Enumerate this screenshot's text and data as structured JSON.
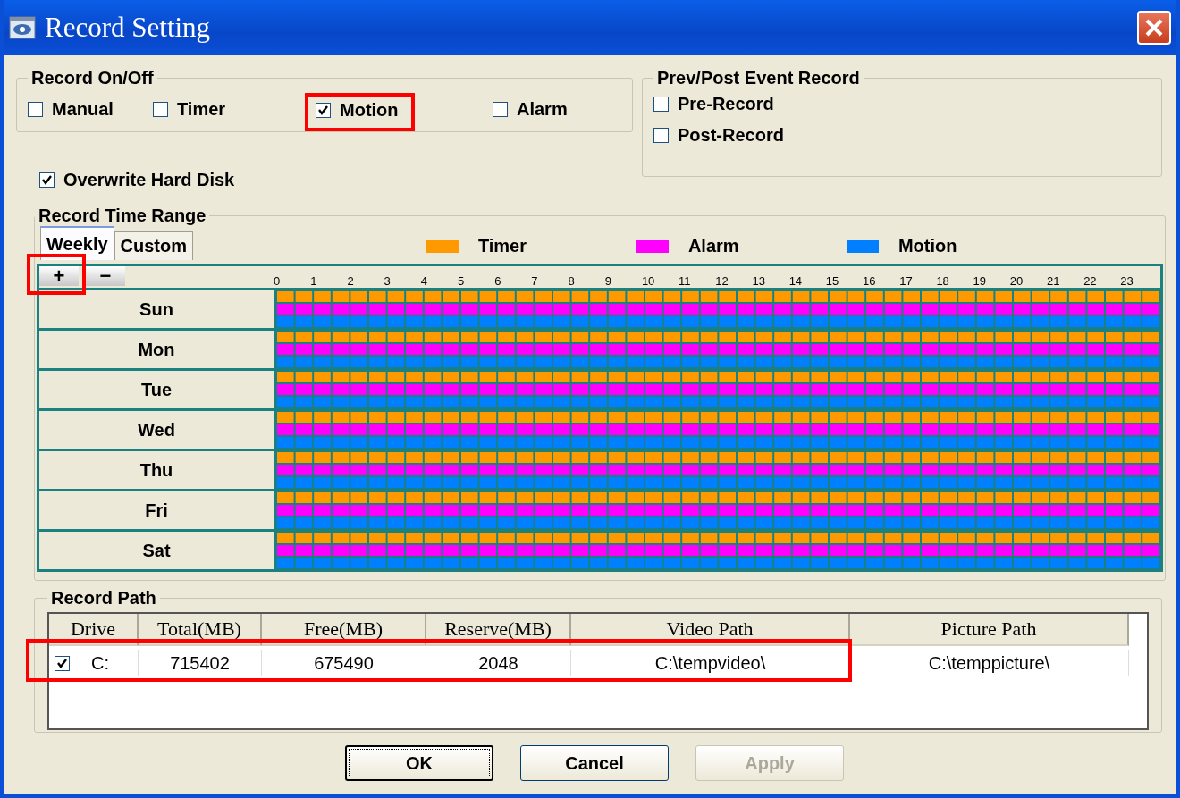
{
  "window": {
    "title": "Record Setting"
  },
  "record_on_off": {
    "title": "Record On/Off",
    "options": [
      {
        "label": "Manual",
        "checked": false,
        "highlighted": false
      },
      {
        "label": "Timer",
        "checked": false,
        "highlighted": false
      },
      {
        "label": "Motion",
        "checked": true,
        "highlighted": true
      },
      {
        "label": "Alarm",
        "checked": false,
        "highlighted": false
      }
    ]
  },
  "overwrite": {
    "label": "Overwrite Hard Disk",
    "checked": true
  },
  "event_record": {
    "title": "Prev/Post Event Record",
    "options": [
      {
        "label": "Pre-Record",
        "checked": false
      },
      {
        "label": "Post-Record",
        "checked": false
      }
    ]
  },
  "time_range": {
    "title": "Record Time Range",
    "tabs": [
      {
        "label": "Weekly",
        "selected": true
      },
      {
        "label": "Custom",
        "selected": false
      }
    ],
    "legend": [
      {
        "label": "Timer",
        "color": "#ff9900"
      },
      {
        "label": "Alarm",
        "color": "#ff00ff"
      },
      {
        "label": "Motion",
        "color": "#0080ff"
      }
    ],
    "zoom_buttons": [
      {
        "label": "+",
        "highlighted": true
      },
      {
        "label": "−",
        "highlighted": false
      }
    ],
    "hours": [
      "0",
      "1",
      "2",
      "3",
      "4",
      "5",
      "6",
      "7",
      "8",
      "9",
      "10",
      "11",
      "12",
      "13",
      "14",
      "15",
      "16",
      "17",
      "18",
      "19",
      "20",
      "21",
      "22",
      "23"
    ],
    "days": [
      {
        "label": "Sun",
        "timer": true,
        "alarm": true,
        "motion": true
      },
      {
        "label": "Mon",
        "timer": true,
        "alarm": true,
        "motion": true
      },
      {
        "label": "Tue",
        "timer": true,
        "alarm": true,
        "motion": true
      },
      {
        "label": "Wed",
        "timer": true,
        "alarm": true,
        "motion": true
      },
      {
        "label": "Thu",
        "timer": true,
        "alarm": true,
        "motion": true
      },
      {
        "label": "Fri",
        "timer": true,
        "alarm": true,
        "motion": true
      },
      {
        "label": "Sat",
        "timer": true,
        "alarm": true,
        "motion": true
      }
    ]
  },
  "record_path": {
    "title": "Record Path",
    "columns": [
      "Drive",
      "Total(MB)",
      "Free(MB)",
      "Reserve(MB)",
      "Video Path",
      "Picture Path"
    ],
    "rows": [
      {
        "checked": true,
        "highlighted": true,
        "cells": [
          "C:",
          "715402",
          "675490",
          "2048",
          "C:\\tempvideo\\",
          "C:\\temppicture\\"
        ]
      }
    ]
  },
  "buttons": [
    {
      "label": "OK",
      "focused": true,
      "disabled": false
    },
    {
      "label": "Cancel",
      "focused": false,
      "disabled": false
    },
    {
      "label": "Apply",
      "focused": false,
      "disabled": true
    }
  ]
}
